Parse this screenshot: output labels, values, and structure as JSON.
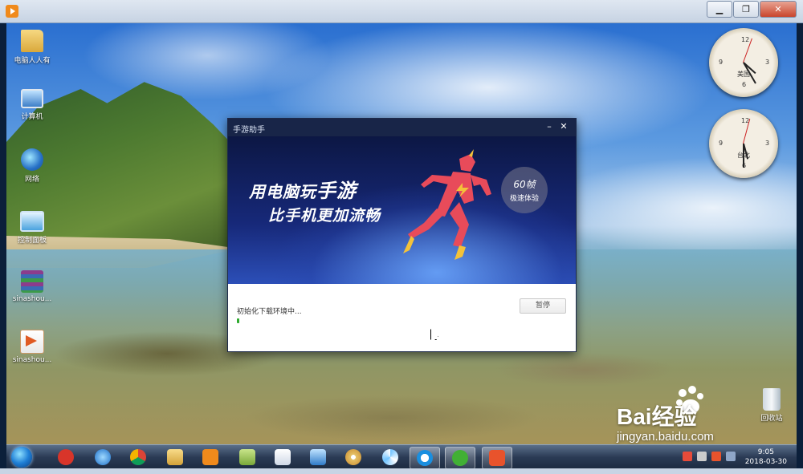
{
  "window": {
    "app_icon": "video-player-icon",
    "controls": [
      "minimize",
      "maximize",
      "close"
    ]
  },
  "desktop": {
    "icons": [
      {
        "label": "电脑人人有",
        "icon": "folder-user-icon"
      },
      {
        "label": "计算机",
        "icon": "computer-icon"
      },
      {
        "label": "网络",
        "icon": "network-globe-icon"
      },
      {
        "label": "控制面板",
        "icon": "control-panel-icon"
      },
      {
        "label": "sinashou...",
        "icon": "winrar-archive-icon"
      },
      {
        "label": "sinashou...",
        "icon": "installer-package-icon"
      }
    ],
    "clocks": [
      {
        "label": "美国",
        "hour": 4,
        "minute": 25
      },
      {
        "label": "台北",
        "hour": 5,
        "minute": 30
      }
    ],
    "recycle_bin": {
      "label": "回收站"
    }
  },
  "dialog": {
    "title": "手游助手",
    "banner": {
      "line1_a": "用电脑玩",
      "line1_b": "手游",
      "line2": "比手机更加流畅",
      "badge_top": "60帧",
      "badge_bottom": "极速体验"
    },
    "status_text": "初始化下载环境中...",
    "pause_label": "暂停",
    "progress": 0.02,
    "colors": {
      "title_bar": "#182548",
      "progress": "#2eaa2e",
      "runner": "#e84b5a"
    }
  },
  "watermark": {
    "brand": "Bai经验",
    "url": "jingyan.baidu.com"
  },
  "taskbar": {
    "items": [
      "start-orb",
      "jiang-app-icon",
      "internet-explorer-icon",
      "chrome-icon",
      "file-explorer-icon",
      "media-player-icon",
      "folder-icon",
      "document-icon",
      "remote-desktop-icon",
      "paint-icon",
      "pinwheel-app-icon",
      "browser-app-icon",
      "wechat-icon",
      "game-assistant-icon"
    ],
    "time": "9:05",
    "date": "2018-03-30"
  }
}
